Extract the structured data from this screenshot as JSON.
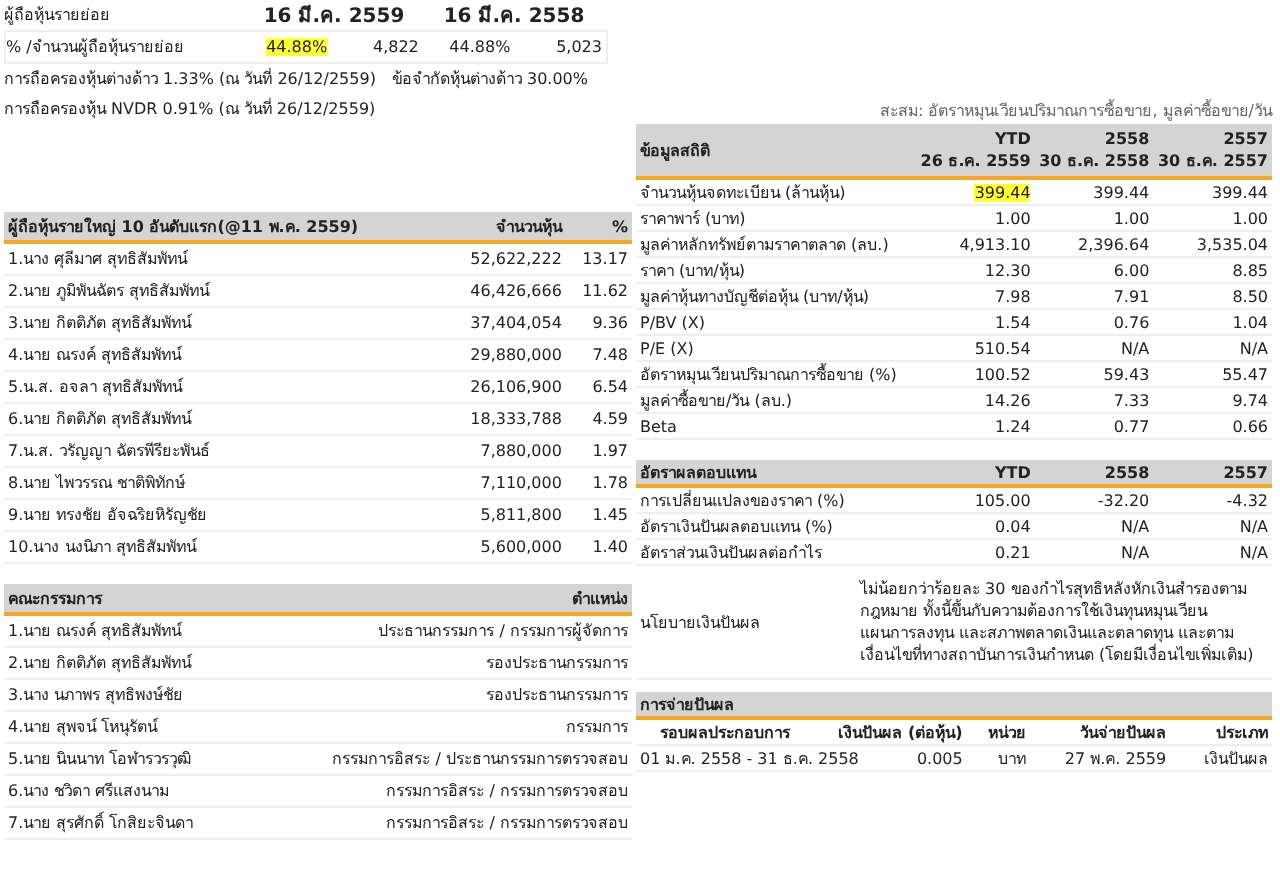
{
  "retail": {
    "label": "ผู้ถือหุ้นรายย่อย",
    "dates": [
      "16 มี.ค. 2559",
      "16 มี.ค. 2558"
    ],
    "row_label": "% /จำนวนผู้ถือหุ้นรายย่อย",
    "values": [
      {
        "text": "44.88%",
        "highlighted": true
      },
      {
        "text": "4,822",
        "highlighted": false
      },
      {
        "text": "44.88%",
        "highlighted": false
      },
      {
        "text": "5,023",
        "highlighted": false
      }
    ]
  },
  "foreign_holding": "การถือครองหุ้นต่างด้าว 1.33% (ณ วันที่ 26/12/2559)",
  "foreign_limit": "ข้อจำกัดหุ้นต่างด้าว 30.00%",
  "nvdr_holding": "การถือครองหุ้น NVDR  0.91% (ณ วันที่ 26/12/2559)",
  "top_shareholders": {
    "columns": [
      "ผู้ถือหุ้นรายใหญ่ 10 อันดับแรก(@11 พ.ค. 2559)",
      "จำนวนหุ้น",
      "%"
    ],
    "rows": [
      {
        "name": "1.นาง ศุลีมาศ สุทธิสัมพัทน์",
        "shares": "52,622,222",
        "pct": "13.17"
      },
      {
        "name": "2.นาย ภูมิพันฉัตร สุทธิสัมพัทน์",
        "shares": "46,426,666",
        "pct": "11.62"
      },
      {
        "name": "3.นาย กิตติภัต สุทธิสัมพัทน์",
        "shares": "37,404,054",
        "pct": "9.36"
      },
      {
        "name": "4.นาย ณรงค์ สุทธิสัมพัทน์",
        "shares": "29,880,000",
        "pct": "7.48"
      },
      {
        "name": "5.น.ส. อจลา สุทธิสัมพัทน์",
        "shares": "26,106,900",
        "pct": "6.54"
      },
      {
        "name": "6.นาย กิตติภัต สุทธิสัมพัทน์",
        "shares": "18,333,788",
        "pct": "4.59"
      },
      {
        "name": "7.น.ส. วรัญญา ฉัตรพีรียะพันธ์",
        "shares": "7,880,000",
        "pct": "1.97"
      },
      {
        "name": "8.นาย ไพวรรณ ชาติพิทักษ์",
        "shares": "7,110,000",
        "pct": "1.78"
      },
      {
        "name": "9.นาย ทรงชัย อัจฉริยหิรัญชัย",
        "shares": "5,811,800",
        "pct": "1.45"
      },
      {
        "name": "10.นาง นงนิภา สุทธิสัมพัทน์",
        "shares": "5,600,000",
        "pct": "1.40"
      }
    ]
  },
  "board": {
    "columns": [
      "คณะกรรมการ",
      "ตำแหน่ง"
    ],
    "rows": [
      {
        "name": "1.นาย ณรงค์ สุทธิสัมพัทน์",
        "position": "ประธานกรรมการ / กรรมการผู้จัดการ"
      },
      {
        "name": "2.นาย กิตติภัต สุทธิสัมพัทน์",
        "position": "รองประธานกรรมการ"
      },
      {
        "name": "3.นาง นภาพร สุทธิพงษ์ชัย",
        "position": "รองประธานกรรมการ"
      },
      {
        "name": "4.นาย สุพจน์ โหนุรัตน์",
        "position": "กรรมการ"
      },
      {
        "name": "5.นาย นินนาท โอฬารวรวุฒิ",
        "position": "กรรมการอิสระ / ประธานกรรมการตรวจสอบ"
      },
      {
        "name": "6.นาง ชวิดา ศรีแสงนาม",
        "position": "กรรมการอิสระ / กรรมการตรวจสอบ"
      },
      {
        "name": "7.นาย สุรศักดิ์ โกสิยะจินดา",
        "position": "กรรมการอิสระ / กรรมการตรวจสอบ"
      }
    ]
  },
  "stats_note": "สะสม: อัตราหมุนเวียนปริมาณการซื้อขาย, มูลค่าซื้อขาย/วัน",
  "statistics": {
    "title": "ข้อมูลสถิติ",
    "columns": [
      {
        "period": "YTD",
        "date": "26 ธ.ค. 2559"
      },
      {
        "period": "2558",
        "date": "30 ธ.ค. 2558"
      },
      {
        "period": "2557",
        "date": "30 ธ.ค. 2557"
      }
    ],
    "rows": [
      {
        "label": "จำนวนหุ้นจดทะเบียน (ล้านหุ้น)",
        "highlighted": true,
        "values": [
          "399.44",
          "399.44",
          "399.44"
        ]
      },
      {
        "label": "ราคาพาร์ (บาท)",
        "highlighted": false,
        "values": [
          "1.00",
          "1.00",
          "1.00"
        ]
      },
      {
        "label": "มูลค่าหลักทรัพย์ตามราคาตลาด (ลบ.)",
        "highlighted": false,
        "values": [
          "4,913.10",
          "2,396.64",
          "3,535.04"
        ]
      },
      {
        "label": "ราคา (บาท/หุ้น)",
        "highlighted": false,
        "values": [
          "12.30",
          "6.00",
          "8.85"
        ]
      },
      {
        "label": "มูลค่าหุ้นทางบัญชีต่อหุ้น (บาท/หุ้น)",
        "highlighted": false,
        "values": [
          "7.98",
          "7.91",
          "8.50"
        ]
      },
      {
        "label": "P/BV (X)",
        "highlighted": false,
        "values": [
          "1.54",
          "0.76",
          "1.04"
        ]
      },
      {
        "label": "P/E (X)",
        "highlighted": false,
        "values": [
          "510.54",
          "N/A",
          "N/A"
        ]
      },
      {
        "label": "อัตราหมุนเวียนปริมาณการซื้อขาย (%)",
        "highlighted": false,
        "values": [
          "100.52",
          "59.43",
          "55.47"
        ]
      },
      {
        "label": "มูลค่าซื้อขาย/วัน (ลบ.)",
        "highlighted": false,
        "values": [
          "14.26",
          "7.33",
          "9.74"
        ]
      },
      {
        "label": "Beta",
        "highlighted": false,
        "values": [
          "1.24",
          "0.77",
          "0.66"
        ]
      }
    ]
  },
  "returns": {
    "columns": [
      "อัตราผลตอบแทน",
      "YTD",
      "2558",
      "2557"
    ],
    "rows": [
      {
        "label": "การเปลี่ยนแปลงของราคา (%)",
        "values": [
          "105.00",
          "-32.20",
          "-4.32"
        ]
      },
      {
        "label": "อัตราเงินปันผลตอบแทน (%)",
        "values": [
          "0.04",
          "N/A",
          "N/A"
        ]
      },
      {
        "label": "อัตราส่วนเงินปันผลต่อกำไร",
        "values": [
          "0.21",
          "N/A",
          "N/A"
        ]
      }
    ]
  },
  "dividend_policy": {
    "label": "นโยบายเงินปันผล",
    "text": "ไม่น้อยกว่าร้อยละ 30 ของกำไรสุทธิหลังหักเงินสำรองตามกฎหมาย ทั้งนี้ขึ้นกับความต้องการใช้เงินทุนหมุนเวียน แผนการลงทุน และสภาพตลาดเงินและตลาดทุน และตามเงื่อนไขที่ทางสถาบันการเงินกำหนด (โดยมีเงื่อนไขเพิ่มเติม)"
  },
  "dividend_payments": {
    "title": "การจ่ายปันผล",
    "columns": [
      "รอบผลประกอบการ",
      "เงินปันผล (ต่อหุ้น)",
      "หน่วย",
      "วันจ่ายปันผล",
      "ประเภท"
    ],
    "rows": [
      [
        "01 ม.ค. 2558 - 31 ธ.ค. 2558",
        "0.005",
        "บาท",
        "27 พ.ค. 2559",
        "เงินปันผล"
      ]
    ]
  }
}
